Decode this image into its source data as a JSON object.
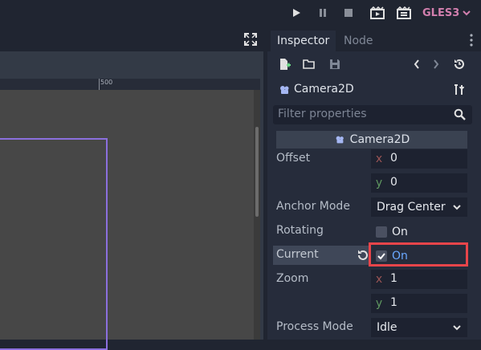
{
  "toolbar": {
    "renderer": "GLES3",
    "play_icon": "play-icon",
    "pause_icon": "pause-icon",
    "stop_icon": "stop-icon",
    "play_scene_icon": "play-scene-icon",
    "play_custom_icon": "play-custom-scene-icon"
  },
  "viewport": {
    "ruler_label": "500",
    "camera_rect_color": "#8b6fdd"
  },
  "dock": {
    "tabs": [
      {
        "label": "Inspector",
        "active": true
      },
      {
        "label": "Node",
        "active": false
      }
    ],
    "node_name": "Camera2D",
    "filter_placeholder": "Filter properties",
    "section_title": "Camera2D"
  },
  "properties": {
    "offset": {
      "label": "Offset",
      "x_axis": "x",
      "x": "0",
      "y_axis": "y",
      "y": "0"
    },
    "anchor_mode": {
      "label": "Anchor Mode",
      "value": "Drag Center"
    },
    "rotating": {
      "label": "Rotating",
      "checked": false,
      "value": "On"
    },
    "current": {
      "label": "Current",
      "checked": true,
      "value": "On"
    },
    "zoom": {
      "label": "Zoom",
      "x_axis": "x",
      "x": "1",
      "y_axis": "y",
      "y": "1"
    },
    "process_mode": {
      "label": "Process Mode",
      "value": "Idle"
    }
  },
  "colors": {
    "accent": "#d27fae",
    "highlight": "#e8454a",
    "checked_text": "#6aa8ff"
  }
}
